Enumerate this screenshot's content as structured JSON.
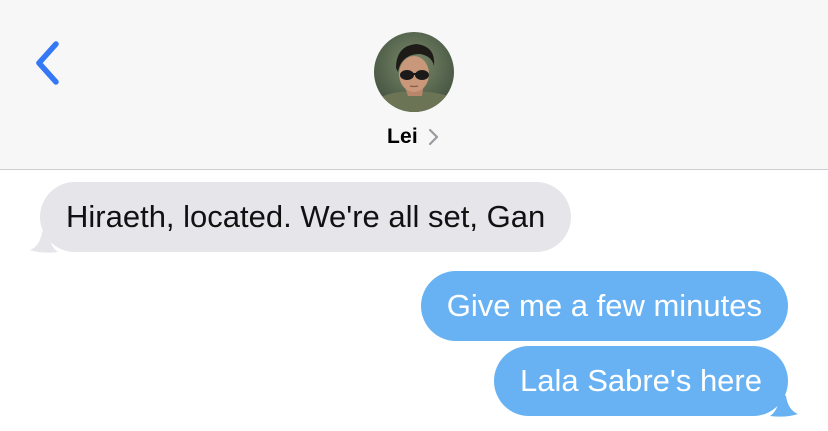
{
  "header": {
    "back_icon": "chevron-left-icon",
    "contact_name": "Lei",
    "contact_chevron_icon": "chevron-right-icon",
    "avatar_alt": "contact-photo"
  },
  "colors": {
    "header_bg": "#f7f7f7",
    "accent": "#3478f6",
    "incoming_bubble": "#e5e5ea",
    "outgoing_bubble": "#68b2f3"
  },
  "messages": [
    {
      "direction": "incoming",
      "text": "Hiraeth, located. We're all set, Gan"
    },
    {
      "direction": "outgoing",
      "text": "Give me a few minutes"
    },
    {
      "direction": "outgoing",
      "text": "Lala Sabre's here"
    }
  ]
}
